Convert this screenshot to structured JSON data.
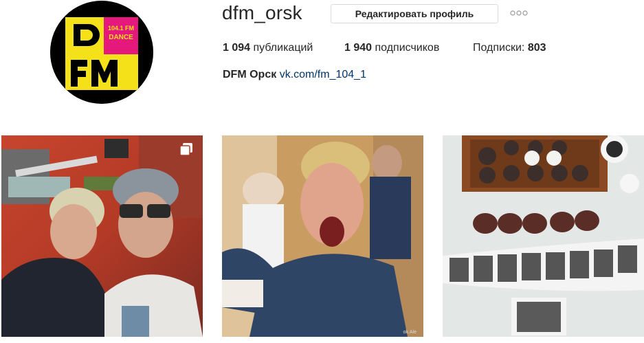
{
  "profile": {
    "username": "dfm_orsk",
    "edit_button": "Редактировать профиль",
    "more_icon": "ellipsis-icon",
    "stats": {
      "posts_count": "1 094",
      "posts_label": "публикаций",
      "followers_count": "1 940",
      "followers_label": "подписчиков",
      "following_label": "Подписки:",
      "following_count": "803"
    },
    "bio": {
      "name": "DFM Орск",
      "link": "vk.com/fm_104_1"
    },
    "avatar": {
      "freq": "104.1 FM",
      "genre": "DANCE",
      "letters_top": "D",
      "letters_bottom": "FM",
      "colors": {
        "yellow": "#f5e11a",
        "pink": "#e5197c",
        "black": "#000000"
      }
    }
  },
  "posts": [
    {
      "id": "post-1",
      "description_icon": "multiple-photos-icon",
      "watermark": ""
    },
    {
      "id": "post-2",
      "description_icon": "",
      "watermark": "ok.Ale"
    },
    {
      "id": "post-3",
      "description_icon": "",
      "watermark": ""
    }
  ]
}
